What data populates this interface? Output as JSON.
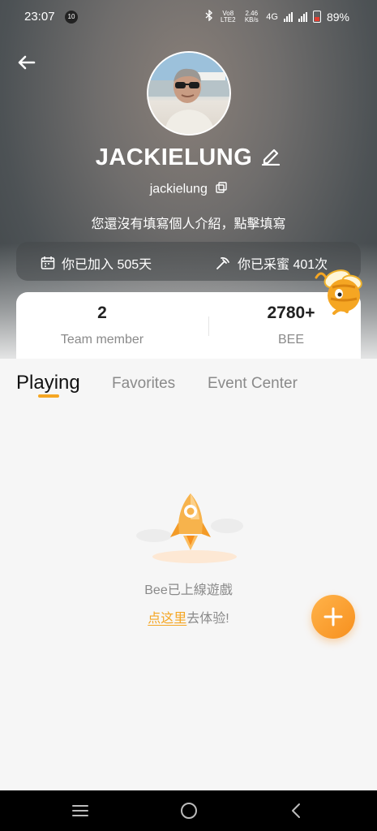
{
  "status_bar": {
    "time": "23:07",
    "notification_badge": "10",
    "network_text": "Vo8 LTE2",
    "speed_text": "2.46 KB/s",
    "network_type": "4G",
    "battery_percent": "89%"
  },
  "profile": {
    "display_name": "JACKIELUNG",
    "handle": "jackielung",
    "bio_prompt": "您還沒有填寫個人介紹，點擊填寫",
    "joined_text": "你已加入 505天",
    "honey_text": "你已采蜜 401次"
  },
  "stats": {
    "team_count": "2",
    "team_label": "Team member",
    "bee_count": "2780+",
    "bee_label": "BEE"
  },
  "tabs": [
    {
      "label": "Playing",
      "active": true
    },
    {
      "label": "Favorites",
      "active": false
    },
    {
      "label": "Event Center",
      "active": false
    }
  ],
  "empty_state": {
    "message": "Bee已上線遊戲",
    "link_text": "点这里",
    "link_suffix": "去体验!"
  },
  "colors": {
    "accent": "#f5a623",
    "card_bg": "#ffffff",
    "page_bg": "#f6f6f6"
  },
  "icons": {
    "back": "arrow-left-icon",
    "edit": "pencil-icon",
    "copy": "copy-icon",
    "calendar": "calendar-icon",
    "pickaxe": "pickaxe-icon",
    "fab": "plus-icon"
  }
}
